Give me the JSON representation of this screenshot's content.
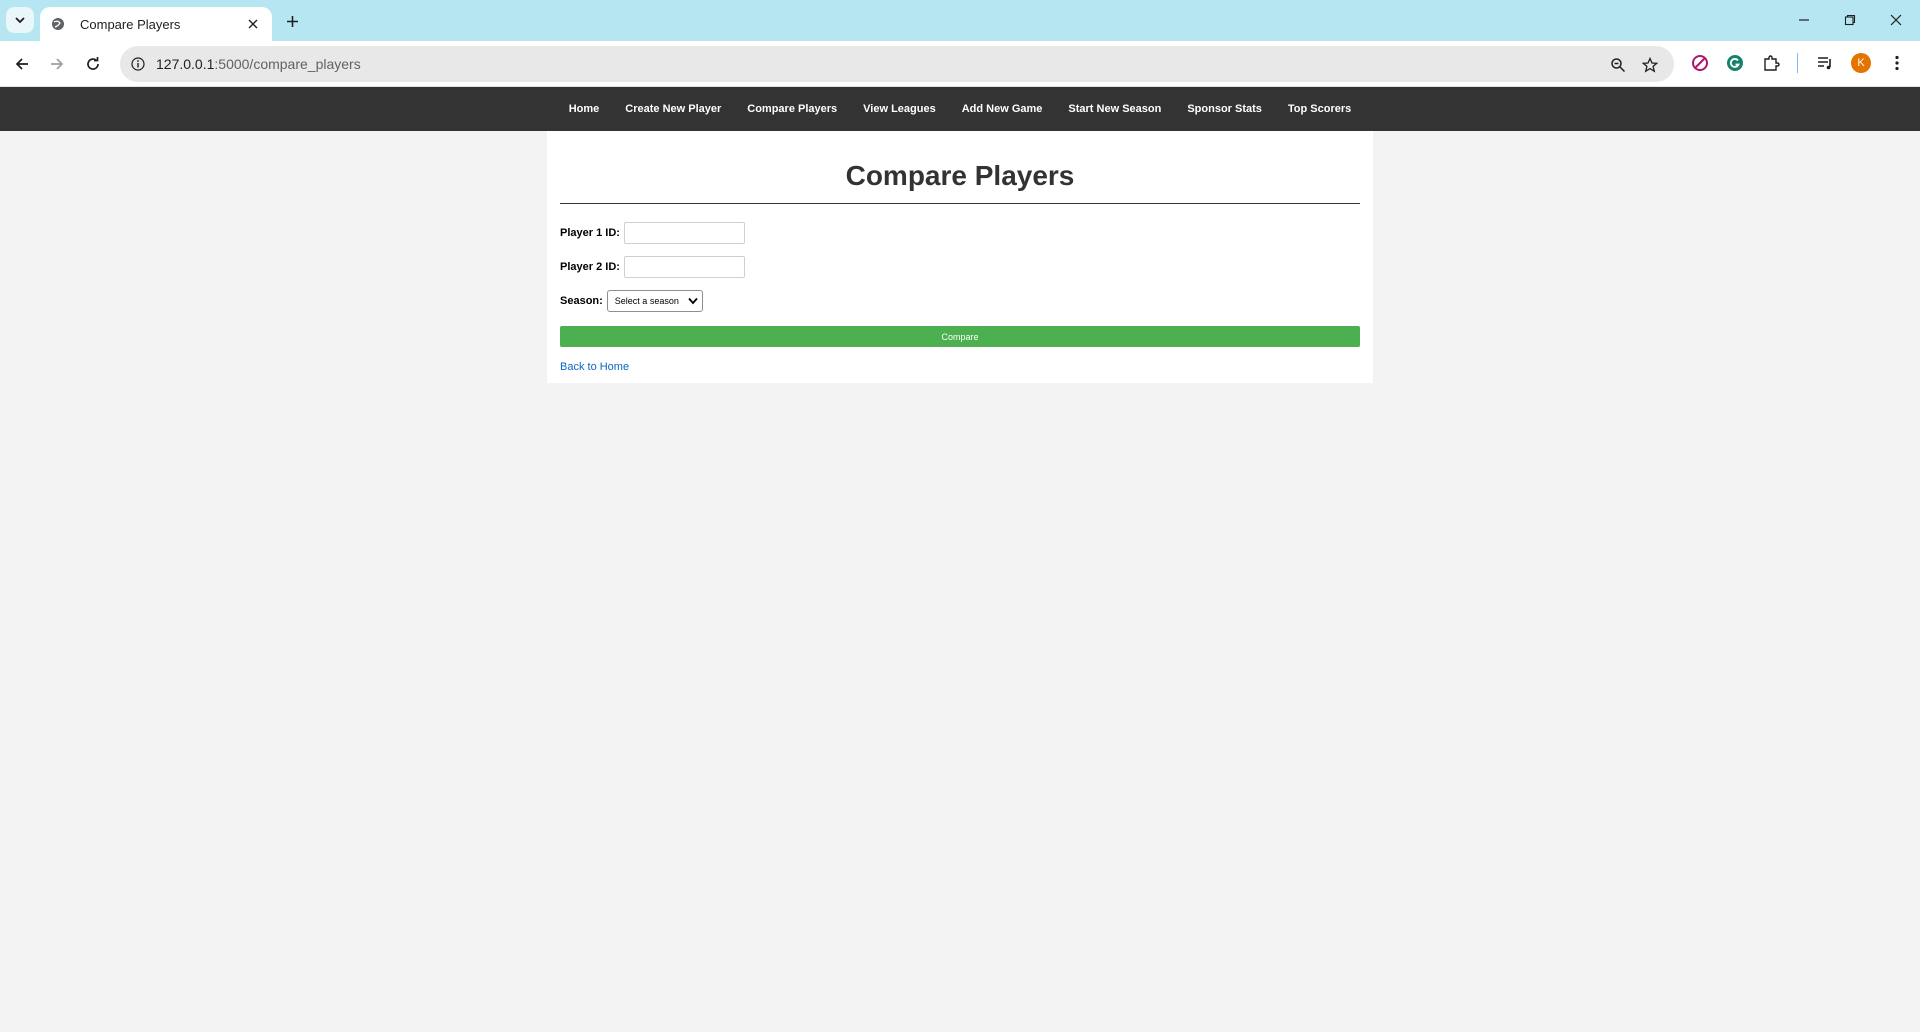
{
  "browser": {
    "tab_title": "Compare Players",
    "url_host": "127.0.0.1",
    "url_path": ":5000/compare_players",
    "avatar_letter": "K"
  },
  "nav": {
    "items": [
      {
        "label": "Home"
      },
      {
        "label": "Create New Player"
      },
      {
        "label": "Compare Players"
      },
      {
        "label": "View Leagues"
      },
      {
        "label": "Add New Game"
      },
      {
        "label": "Start New Season"
      },
      {
        "label": "Sponsor Stats"
      },
      {
        "label": "Top Scorers"
      }
    ]
  },
  "form": {
    "title": "Compare Players",
    "player1_label": "Player 1 ID:",
    "player1_value": "",
    "player2_label": "Player 2 ID:",
    "player2_value": "",
    "season_label": "Season:",
    "season_selected": "Select a season",
    "submit_label": "Compare",
    "back_link": "Back to Home"
  },
  "colors": {
    "nav_bg": "#333333",
    "button_bg": "#4caf50",
    "link": "#0a66c2",
    "tabbar_bg": "#b5e6f2"
  }
}
